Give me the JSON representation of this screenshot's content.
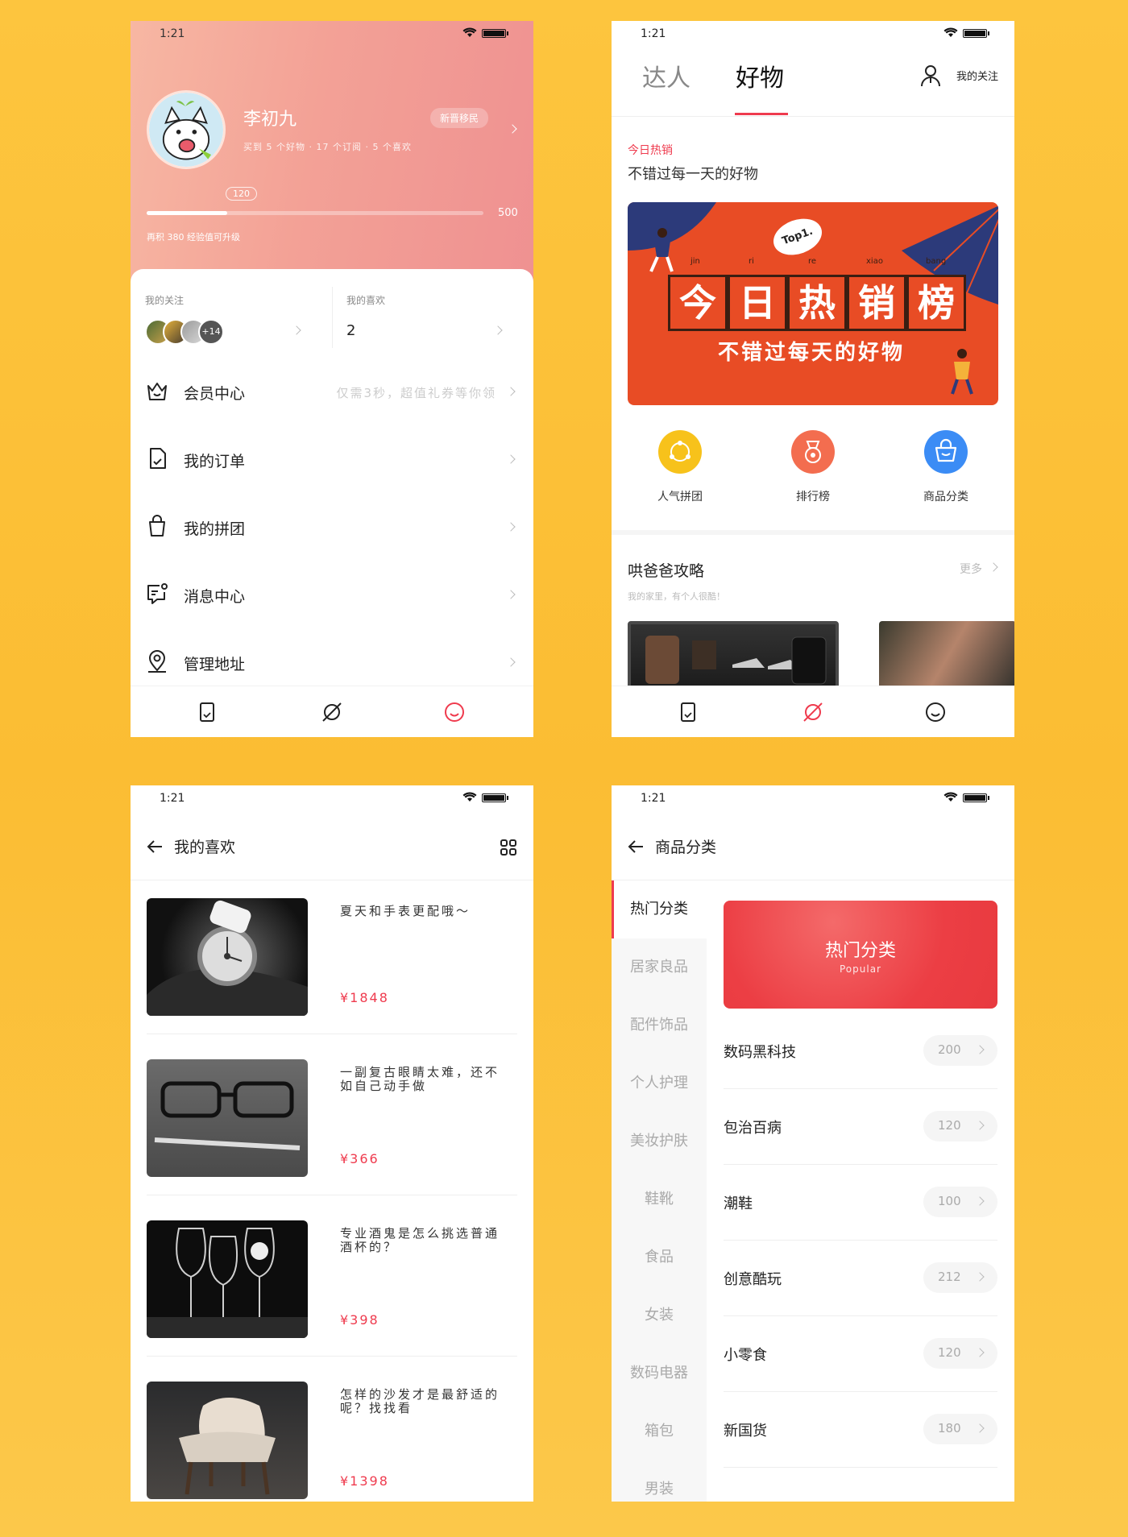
{
  "status_time": "1:21",
  "profile": {
    "name": "李初九",
    "stats": "买到 5 个好物 · 17 个订阅 · 5 个喜欢",
    "badge": "新晋移民",
    "exp_current": "120",
    "exp_max": "500",
    "exp_progress": 0.24,
    "exp_tip": "再积 380 经验值可升级",
    "follow_label": "我的关注",
    "follow_more": "+14",
    "likes_label": "我的喜欢",
    "likes_count": "2",
    "menu": [
      {
        "label": "会员中心",
        "hint": "仅需3秒，超值礼券等你领",
        "icon": "crown-icon"
      },
      {
        "label": "我的订单",
        "hint": "",
        "icon": "order-icon"
      },
      {
        "label": "我的拼团",
        "hint": "",
        "icon": "bag-icon"
      },
      {
        "label": "消息中心",
        "hint": "",
        "icon": "message-icon"
      },
      {
        "label": "管理地址",
        "hint": "",
        "icon": "location-icon"
      }
    ]
  },
  "discover": {
    "tabs": [
      "达人",
      "好物"
    ],
    "active_tab": "好物",
    "follow": "我的关注",
    "hot_title": "今日热销",
    "hot_subtitle": "不错过每一天的好物",
    "banner_words": [
      "今",
      "日",
      "热",
      "销",
      "榜"
    ],
    "banner_pinyin": [
      "jin",
      "ri",
      "re",
      "xiao",
      "bang"
    ],
    "banner_sub": "不错过每天的好物",
    "banner_tag": "Top1.",
    "quick": [
      {
        "label": "人气拼团",
        "color": "#f7c21b",
        "icon": "group-icon"
      },
      {
        "label": "排行榜",
        "color": "#f36d4f",
        "icon": "medal-icon"
      },
      {
        "label": "商品分类",
        "color": "#3b8cf5",
        "icon": "basket-icon"
      }
    ],
    "article_title": "哄爸爸攻略",
    "article_more": "更多",
    "article_sub": "我的家里，有个人很酷！"
  },
  "favorites": {
    "title": "我的喜欢",
    "items": [
      {
        "title": "夏天和手表更配哦～",
        "price": "¥1848"
      },
      {
        "title": "一副复古眼睛太难，还不如自己动手做",
        "price": "¥366"
      },
      {
        "title": "专业酒鬼是怎么挑选普通酒杯的？",
        "price": "¥398"
      },
      {
        "title": "怎样的沙发才是最舒适的呢？找找看",
        "price": "¥1398"
      }
    ]
  },
  "category": {
    "title": "商品分类",
    "sidebar": [
      "热门分类",
      "居家良品",
      "配件饰品",
      "个人护理",
      "美妆护肤",
      "鞋靴",
      "食品",
      "女装",
      "数码电器",
      "箱包",
      "男装"
    ],
    "active": "热门分类",
    "card_title": "热门分类",
    "card_sub": "Popular",
    "rows": [
      {
        "name": "数码黑科技",
        "count": "200"
      },
      {
        "name": "包治百病",
        "count": "120"
      },
      {
        "name": "潮鞋",
        "count": "100"
      },
      {
        "name": "创意酷玩",
        "count": "212"
      },
      {
        "name": "小零食",
        "count": "120"
      },
      {
        "name": "新国货",
        "count": "180"
      }
    ]
  },
  "colors": {
    "accent": "#ef3b4e",
    "background": "#fcc440"
  }
}
